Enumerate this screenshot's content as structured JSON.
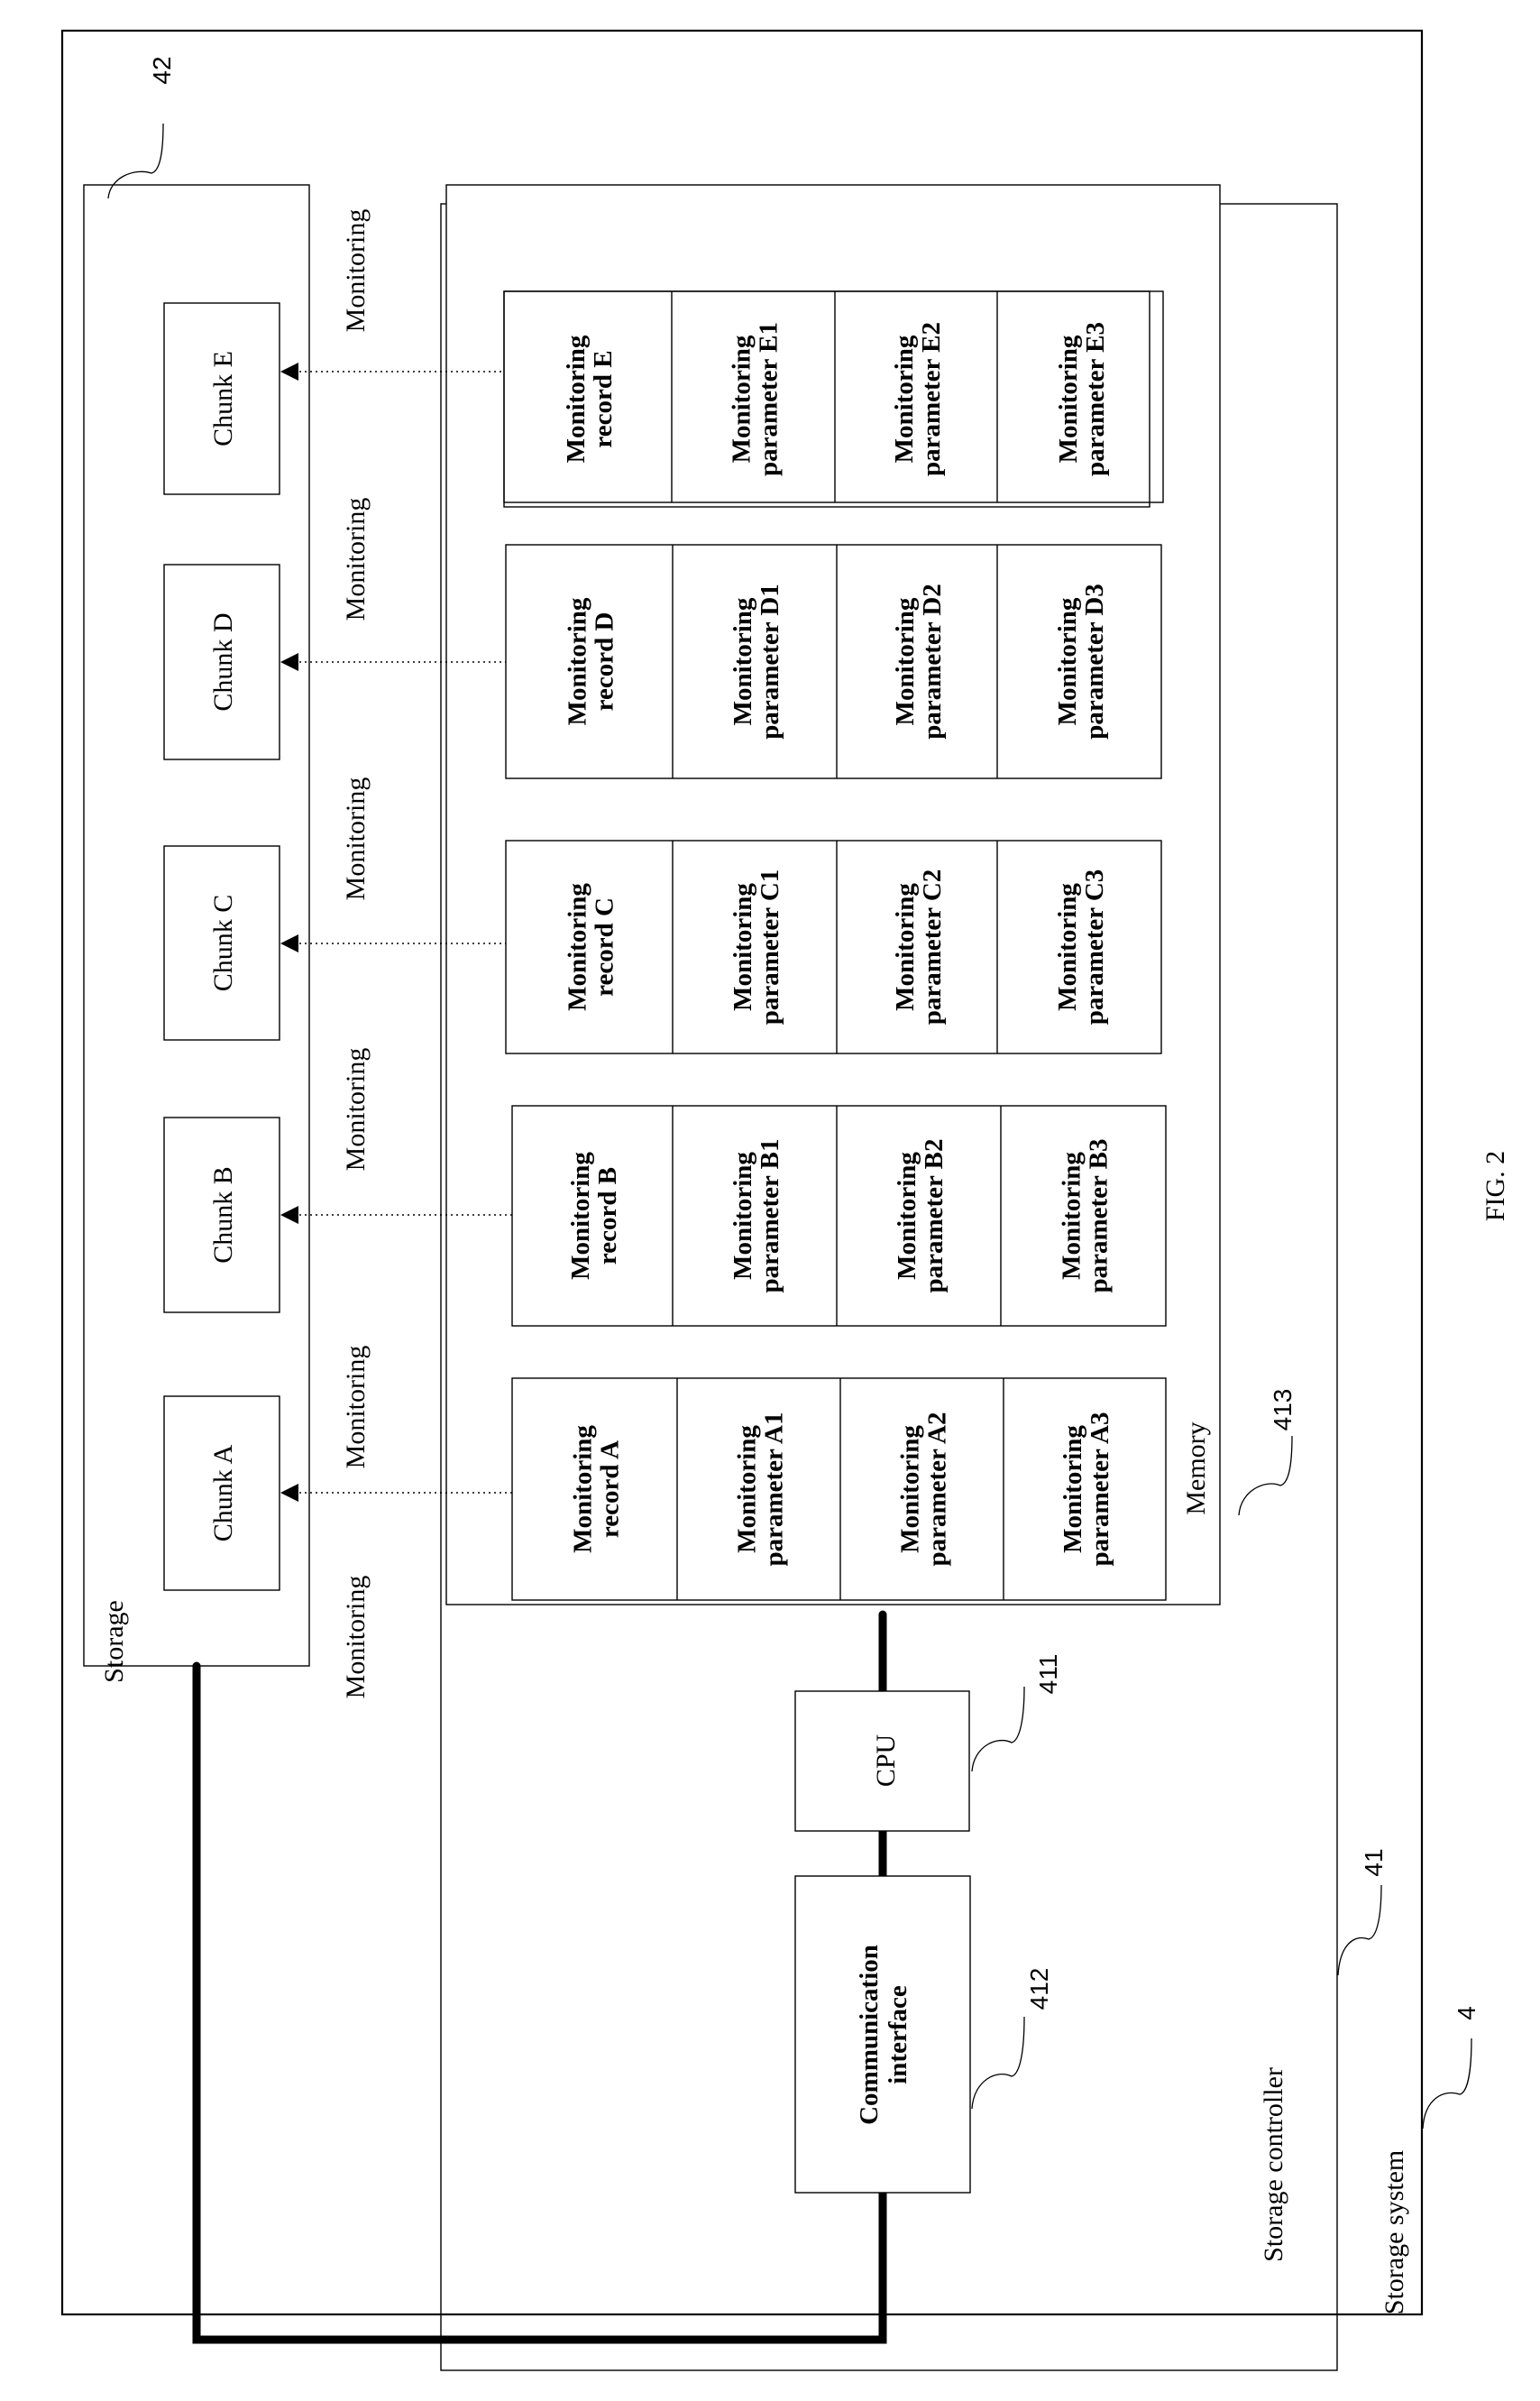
{
  "figure": {
    "caption": "FIG. 2",
    "orientation": "rotated 90 degrees counter-clockwise (text reads bottom-to-top)"
  },
  "storage_system": {
    "label": "Storage system",
    "ref": "4"
  },
  "storage": {
    "label": "Storage",
    "ref": "42",
    "chunks": [
      {
        "id": "E",
        "label": "Chunk E"
      },
      {
        "id": "D",
        "label": "Chunk D"
      },
      {
        "id": "C",
        "label": "Chunk C"
      },
      {
        "id": "B",
        "label": "Chunk B"
      },
      {
        "id": "A",
        "label": "Chunk A"
      }
    ]
  },
  "monitoring_labels": [
    "Monitoring",
    "Monitoring",
    "Monitoring",
    "Monitoring",
    "Monitoring",
    "Monitoring"
  ],
  "storage_controller": {
    "label": "Storage controller",
    "ref": "41",
    "cpu": {
      "label": "CPU",
      "ref": "411"
    },
    "communication_interface": {
      "line1": "Communication",
      "line2": "interface",
      "ref": "412"
    },
    "memory": {
      "label": "Memory",
      "ref": "413",
      "records": [
        {
          "id": "E",
          "record": [
            "Monitoring",
            "record E"
          ],
          "params": [
            [
              "Monitoring",
              "parameter E1"
            ],
            [
              "Monitoring",
              "parameter E2"
            ],
            [
              "Monitoring",
              "parameter E3"
            ]
          ]
        },
        {
          "id": "D",
          "record": [
            "Monitoring",
            "record D"
          ],
          "params": [
            [
              "Monitoring",
              "parameter D1"
            ],
            [
              "Monitoring",
              "parameter D2"
            ],
            [
              "Monitoring",
              "parameter D3"
            ]
          ]
        },
        {
          "id": "C",
          "record": [
            "Monitoring",
            "record C"
          ],
          "params": [
            [
              "Monitoring",
              "parameter C1"
            ],
            [
              "Monitoring",
              "parameter C2"
            ],
            [
              "Monitoring",
              "parameter C3"
            ]
          ]
        },
        {
          "id": "B",
          "record": [
            "Monitoring",
            "record B"
          ],
          "params": [
            [
              "Monitoring",
              "parameter B1"
            ],
            [
              "Monitoring",
              "parameter B2"
            ],
            [
              "Monitoring",
              "parameter B3"
            ]
          ]
        },
        {
          "id": "A",
          "record": [
            "Monitoring",
            "record A"
          ],
          "params": [
            [
              "Monitoring",
              "parameter A1"
            ],
            [
              "Monitoring",
              "parameter A2"
            ],
            [
              "Monitoring",
              "parameter A3"
            ]
          ]
        }
      ]
    }
  }
}
